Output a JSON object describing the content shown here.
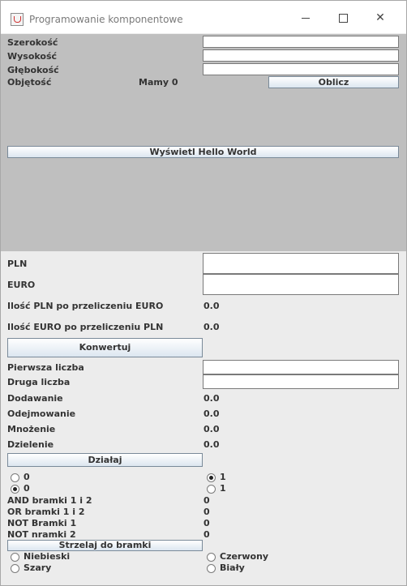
{
  "window": {
    "title": "Programowanie komponentowe"
  },
  "volume": {
    "width_label": "Szerokość",
    "height_label": "Wysokość",
    "depth_label": "Głębokość",
    "volume_label": "Objętość",
    "result_text": "Mamy 0",
    "compute_button": "Oblicz"
  },
  "hello": {
    "button": "Wyświetl Hello World"
  },
  "currency": {
    "pln_label": "PLN",
    "euro_label": "EURO",
    "pln_in_euro_label": "Ilość PLN po przeliczeniu EURO",
    "pln_in_euro_value": "0.0",
    "euro_in_pln_label": "Ilość EURO po przeliczeniu PLN",
    "euro_in_pln_value": "0.0",
    "convert_button": "Konwertuj"
  },
  "calc": {
    "first_label": "Pierwsza liczba",
    "second_label": "Druga liczba",
    "add_label": "Dodawanie",
    "add_value": "0.0",
    "sub_label": "Odejmowanie",
    "sub_value": "0.0",
    "mul_label": "Mnożenie",
    "mul_value": "0.0",
    "div_label": "Dzielenie",
    "div_value": "0.0",
    "run_button": "Działaj"
  },
  "logic": {
    "a0": "0",
    "a1": "1",
    "b0": "0",
    "b1": "1",
    "a_selected": "1",
    "b_selected": "0",
    "and_label": "AND bramki 1 i 2",
    "and_value": "0",
    "or_label": "OR bramki 1 i 2",
    "or_value": "0",
    "not1_label": "NOT Bramki 1",
    "not1_value": "0",
    "not2_label": "NOT nramki 2",
    "not2_value": "0",
    "shoot_button": "Strzelaj do bramki"
  },
  "colors": {
    "blue": "Niebieski",
    "red": "Czerwony",
    "gray": "Szary",
    "white": "Biały"
  }
}
